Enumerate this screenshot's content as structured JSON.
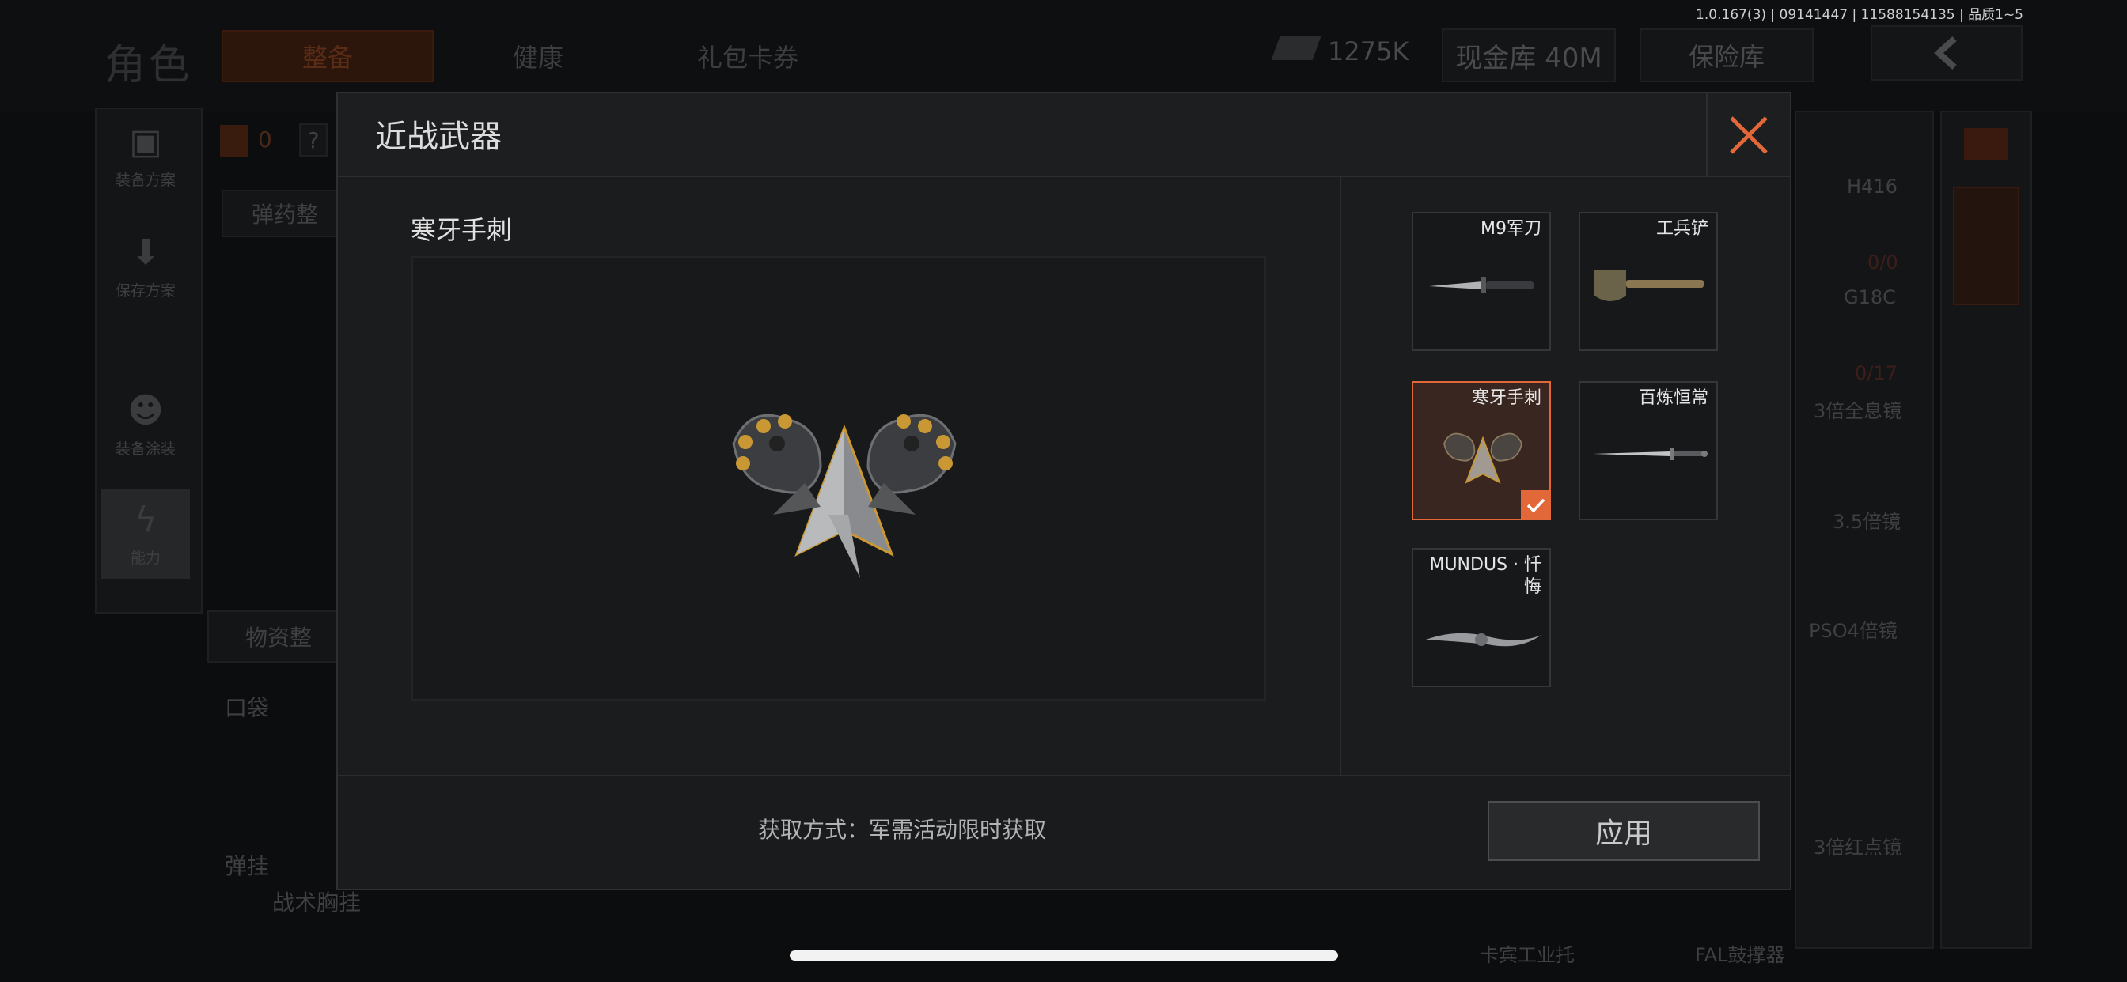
{
  "status_bar": {
    "version": "1.0.167(3) | 09141447 | 11588154135 | 品质1~5"
  },
  "background": {
    "title": "角色",
    "tabs": [
      "整备",
      "健康",
      "礼包卡券"
    ],
    "currency_value": "1275K",
    "cash_vault": "现金库 40M",
    "safe_box": "保险库",
    "side_menu": [
      "装备方案",
      "保存方案",
      "装备涂装",
      "能力"
    ],
    "ammo_section": "弹药整",
    "supply_section": "物资整",
    "pocket_label": "口袋",
    "sling_label": "弹挂",
    "vest_label": "战术胸挂",
    "weapon_list": [
      "H416",
      "G18C",
      "3倍全息镜",
      "3.5倍镜",
      "PSO4倍镜",
      "3倍红点镜",
      "FAL鼓撑器",
      "卡宾工业托"
    ],
    "ammo_counts": [
      "0/0",
      "0/17"
    ],
    "counter": "0"
  },
  "modal": {
    "title": "近战武器",
    "selected_item_name": "寒牙手刺",
    "acquisition_text": "获取方式：军需活动限时获取",
    "apply_label": "应用",
    "accent_color": "#e2683a",
    "items": [
      {
        "name": "M9军刀",
        "icon": "bayonet-icon",
        "selected": false
      },
      {
        "name": "工兵铲",
        "icon": "shovel-icon",
        "selected": false
      },
      {
        "name": "寒牙手刺",
        "icon": "claw-blade-icon",
        "selected": true
      },
      {
        "name": "百炼恒常",
        "icon": "sword-icon",
        "selected": false
      },
      {
        "name": "MUNDUS · 忏悔",
        "icon": "dagger-icon",
        "selected": false
      }
    ]
  }
}
